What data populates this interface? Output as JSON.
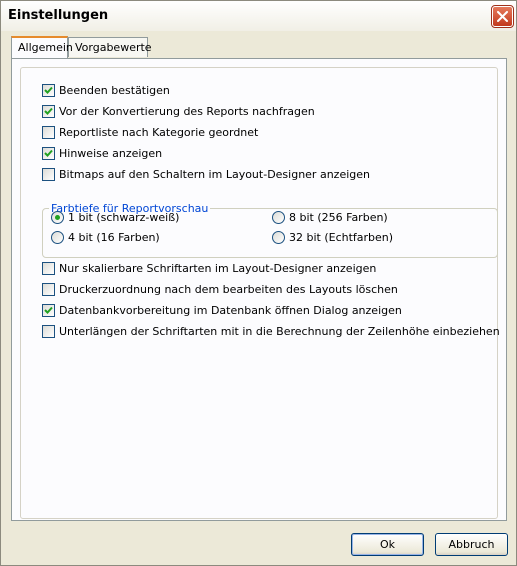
{
  "window": {
    "title": "Einstellungen"
  },
  "tabs": [
    {
      "label": "Allgemein",
      "active": true
    },
    {
      "label": "Vorgabewerte",
      "active": false
    }
  ],
  "options_top": [
    {
      "label": "Beenden bestätigen",
      "checked": true
    },
    {
      "label": "Vor der Konvertierung des Reports nachfragen",
      "checked": true
    },
    {
      "label": "Reportliste nach Kategorie geordnet",
      "checked": false
    },
    {
      "label": "Hinweise anzeigen",
      "checked": true
    },
    {
      "label": "Bitmaps auf den Schaltern im Layout-Designer anzeigen",
      "checked": false
    }
  ],
  "color_depth": {
    "label": "Farbtiefe für Reportvorschau",
    "options": [
      {
        "label": "1 bit (schwarz-weiß)",
        "selected": true
      },
      {
        "label": "8 bit (256 Farben)",
        "selected": false
      },
      {
        "label": "4 bit (16 Farben)",
        "selected": false
      },
      {
        "label": "32 bit (Echtfarben)",
        "selected": false
      }
    ]
  },
  "options_bottom": [
    {
      "label": "Nur skalierbare Schriftarten im Layout-Designer anzeigen",
      "checked": false
    },
    {
      "label": "Druckerzuordnung nach dem bearbeiten des Layouts löschen",
      "checked": false
    },
    {
      "label": "Datenbankvorbereitung im Datenbank öffnen Dialog anzeigen",
      "checked": true
    },
    {
      "label": "Unterlängen der Schriftarten mit in die Berechnung der Zeilenhöhe einbeziehen",
      "checked": false
    }
  ],
  "buttons": {
    "ok": "Ok",
    "cancel": "Abbruch"
  },
  "icons": {
    "close": "close-icon",
    "check": "checkmark-icon"
  },
  "colors": {
    "group_label": "#0046d5",
    "check": "#21a121",
    "close": "#c1391d",
    "tab_accent": "#e68b2c"
  }
}
